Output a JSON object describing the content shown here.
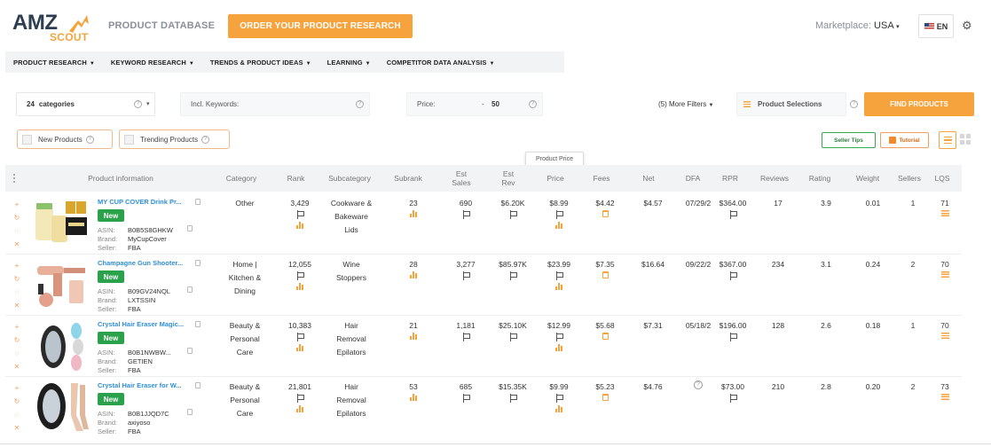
{
  "brand": {
    "logo_main": "AMZ",
    "logo_sub": "SCOUT"
  },
  "header": {
    "title": "PRODUCT DATABASE",
    "order_button": "ORDER YOUR PRODUCT RESEARCH",
    "marketplace_label": "Marketplace:",
    "marketplace_value": "USA",
    "language": "EN"
  },
  "nav": [
    "PRODUCT RESEARCH",
    "KEYWORD RESEARCH",
    "TRENDS & PRODUCT IDEAS",
    "LEARNING",
    "COMPETITOR DATA ANALYSIS"
  ],
  "filters": {
    "categories_count": "24",
    "categories_label": "categories",
    "keywords_label": "Incl. Keywords:",
    "price_label": "Price:",
    "price_min": "-",
    "price_max": "50",
    "more_filters": "(5) More Filters",
    "product_selections": "Product Selections",
    "find_button": "FIND PRODUCTS"
  },
  "chips": {
    "new_products": "New Products",
    "trending_products": "Trending Products"
  },
  "tools": {
    "seller_tips": "Seller Tips",
    "tutorial": "Tutorial"
  },
  "tooltip": "Product Price",
  "columns": {
    "product": "Product information",
    "category": "Category",
    "rank": "Rank",
    "subcategory": "Subcategory",
    "subrank": "Subrank",
    "est_sales": "Est Sales",
    "est_rev": "Est Rev",
    "price": "Price",
    "fees": "Fees",
    "net": "Net",
    "dfa": "DFA",
    "rpr": "RPR",
    "reviews": "Reviews",
    "rating": "Rating",
    "weight": "Weight",
    "sellers": "Sellers",
    "lqs": "LQS"
  },
  "meta_labels": {
    "asin": "ASIN:",
    "brand": "Brand:",
    "seller": "Seller:"
  },
  "new_badge": "New",
  "rows": [
    {
      "title": "MY CUP COVER Drink Pr...",
      "asin": "B0B5S8GHKW",
      "brand": "MyCupCover",
      "seller": "FBA",
      "category": [
        "Other"
      ],
      "rank": "3,429",
      "subcategory": [
        "Cookware &",
        "Bakeware",
        "Lids"
      ],
      "subrank": "23",
      "est_sales": "690",
      "est_rev": "$6.20K",
      "price": "$8.99",
      "fees": "$4.42",
      "net": "$4.57",
      "dfa": "07/29/2",
      "rpr": "$364.00",
      "reviews": "17",
      "rating": "3.9",
      "weight": "0.01",
      "sellers": "1",
      "lqs": "71"
    },
    {
      "title": "Champagne Gun Shooter...",
      "asin": "B09GV24NQL",
      "brand": "LXTSSIN",
      "seller": "FBA",
      "category": [
        "Home |",
        "Kitchen &",
        "Dining"
      ],
      "rank": "12,055",
      "subcategory": [
        "Wine",
        "Stoppers"
      ],
      "subrank": "28",
      "est_sales": "3,277",
      "est_rev": "$85.97K",
      "price": "$23.99",
      "fees": "$7.35",
      "net": "$16.64",
      "dfa": "09/22/2",
      "rpr": "$367.00",
      "reviews": "234",
      "rating": "3.1",
      "weight": "0.24",
      "sellers": "2",
      "lqs": "70"
    },
    {
      "title": "Crystal Hair Eraser Magic...",
      "asin": "B0B1NWBW...",
      "brand": "GETIEN",
      "seller": "FBA",
      "category": [
        "Beauty &",
        "Personal",
        "Care"
      ],
      "rank": "10,383",
      "subcategory": [
        "Hair",
        "Removal",
        "Epilators"
      ],
      "subrank": "21",
      "est_sales": "1,181",
      "est_rev": "$25.10K",
      "price": "$12.99",
      "fees": "$5.68",
      "net": "$7.31",
      "dfa": "05/18/2",
      "rpr": "$196.00",
      "reviews": "128",
      "rating": "2.6",
      "weight": "0.18",
      "sellers": "1",
      "lqs": "70"
    },
    {
      "title": "Crystal Hair Eraser for W...",
      "asin": "B0B1JJQD7C",
      "brand": "axiyoso",
      "seller": "FBA",
      "category": [
        "Beauty &",
        "Personal",
        "Care"
      ],
      "rank": "21,801",
      "subcategory": [
        "Hair",
        "Removal",
        "Epilators"
      ],
      "subrank": "53",
      "est_sales": "685",
      "est_rev": "$15.35K",
      "price": "$9.99",
      "fees": "$5.23",
      "net": "$4.76",
      "dfa": "?",
      "rpr": "$73.00",
      "reviews": "210",
      "rating": "2.8",
      "weight": "0.20",
      "sellers": "2",
      "lqs": "73"
    }
  ]
}
